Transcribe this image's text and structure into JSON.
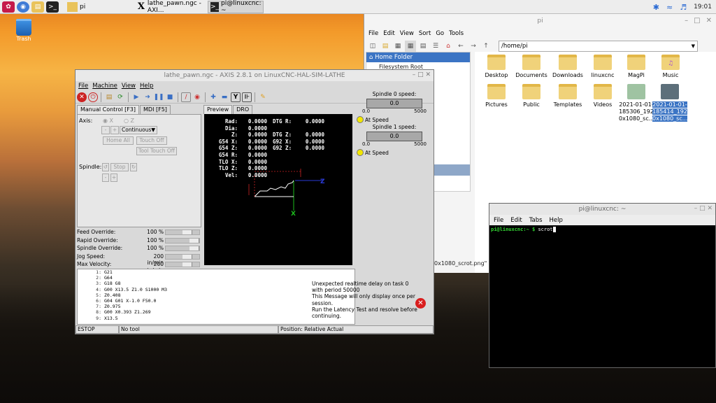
{
  "taskbar": {
    "tasks": [
      {
        "label": "pi",
        "active": false
      },
      {
        "label": "lathe_pawn.ngc - AXI...",
        "active": false
      },
      {
        "label": "pi@linuxcnc: ~",
        "active": true
      }
    ],
    "clock": "19:01"
  },
  "desktop": {
    "trash_label": "Trash"
  },
  "file_manager": {
    "title": "pi",
    "menu": [
      "File",
      "Edit",
      "View",
      "Sort",
      "Go",
      "Tools"
    ],
    "path": "/home/pi",
    "sidebar": {
      "selected": "Home Folder",
      "next": "Filesystem Root"
    },
    "items": [
      {
        "label": "Desktop",
        "icon": "desktop-folder-icon"
      },
      {
        "label": "Documents",
        "icon": "documents-folder-icon"
      },
      {
        "label": "Downloads",
        "icon": "downloads-folder-icon"
      },
      {
        "label": "linuxcnc",
        "icon": "folder-icon"
      },
      {
        "label": "MagPi",
        "icon": "folder-icon"
      },
      {
        "label": "Music",
        "icon": "music-folder-icon"
      },
      {
        "label": "Pictures",
        "icon": "pictures-folder-icon"
      },
      {
        "label": "Public",
        "icon": "public-folder-icon"
      },
      {
        "label": "Templates",
        "icon": "templates-folder-icon"
      },
      {
        "label": "Videos",
        "icon": "videos-folder-icon"
      },
      {
        "label": "2021-01-01-185306_1920x1080_sc...",
        "line1": "2021-01-01-",
        "line2": "185306_192",
        "line3": "0x1080_sc...",
        "icon": "image-file-icon"
      },
      {
        "label": "2021-01-01-185414_1920x1080_sc...",
        "line1": "2021-01-01-",
        "line2": "185414_192",
        "line3": "0x1080_sc...",
        "icon": "image-file-icon",
        "selected": true
      }
    ],
    "status_partial": "0x1080_scrot.png\" (1"
  },
  "terminal": {
    "title": "pi@linuxcnc: ~",
    "menu": [
      "File",
      "Edit",
      "Tabs",
      "Help"
    ],
    "prompt": "pi@linuxcnc:~ $",
    "command": "scrot"
  },
  "axis": {
    "title": "lathe_pawn.ngc - AXIS 2.8.1 on LinuxCNC-HAL-SIM-LATHE",
    "menu": [
      "File",
      "Machine",
      "View",
      "Help"
    ],
    "tabs_left": [
      "Manual Control [F3]",
      "MDI [F5]"
    ],
    "tabs_preview": [
      "Preview",
      "DRO"
    ],
    "manual": {
      "axis_label": "Axis:",
      "axis_x": "X",
      "axis_z": "Z",
      "minus": "-",
      "plus": "+",
      "jog_mode": "Continuous",
      "home_all": "Home All",
      "touch_off": "Touch Off",
      "tool_touch_off": "Tool Touch Off",
      "spindle_label": "Spindle:",
      "stop": "Stop"
    },
    "overrides": [
      {
        "label": "Feed Override:",
        "value": "100 %",
        "level": 0.7
      },
      {
        "label": "Rapid Override:",
        "value": "100 %",
        "level": 1.0
      },
      {
        "label": "Spindle Override:",
        "value": "100 %",
        "level": 1.0
      },
      {
        "label": "Jog Speed:",
        "value": "200 in/min",
        "level": 0.7
      },
      {
        "label": "Max Velocity:",
        "value": "200 in/min",
        "level": 0.7
      }
    ],
    "dro": [
      {
        "l": "Rad:",
        "v": "0.0000",
        "l2": "DTG R:",
        "v2": "0.0000"
      },
      {
        "l": "Dia:",
        "v": "0.0000",
        "l2": "",
        "v2": ""
      },
      {
        "l": "Z:",
        "v": "0.0000",
        "l2": "DTG Z:",
        "v2": "0.0000"
      },
      {
        "l": "G54 X:",
        "v": "0.0000",
        "l2": "G92 X:",
        "v2": "0.0000"
      },
      {
        "l": "G54 Z:",
        "v": "0.0000",
        "l2": "G92 Z:",
        "v2": "0.0000"
      },
      {
        "l": "G54 R:",
        "v": "0.0000",
        "l2": "",
        "v2": ""
      },
      {
        "l": "TLO X:",
        "v": "0.0000",
        "l2": "",
        "v2": ""
      },
      {
        "l": "TLO Z:",
        "v": "0.0000",
        "l2": "",
        "v2": ""
      },
      {
        "l": "Vel:",
        "v": "0.0000",
        "l2": "",
        "v2": ""
      }
    ],
    "preview_axes": {
      "x": "X",
      "z": "Z"
    },
    "spindle0": {
      "label": "Spindle 0 speed:",
      "value": "0.0",
      "min": "0.0",
      "max": "5000",
      "at_speed": "At Speed"
    },
    "spindle1": {
      "label": "Spindle 1 speed:",
      "value": "0.0",
      "min": "0.0",
      "max": "5000",
      "at_speed": "At Speed"
    },
    "gcode": [
      {
        "n": "1:",
        "t": "G21"
      },
      {
        "n": "2:",
        "t": "G64"
      },
      {
        "n": "3:",
        "t": "G18 G8"
      },
      {
        "n": "4:",
        "t": "G00 X13.5 Z1.0 S1000 M3"
      },
      {
        "n": "5:",
        "t": "Z0.408"
      },
      {
        "n": "6:",
        "t": "G04 G01 X-1.0 F50.0"
      },
      {
        "n": "7:",
        "t": "Z0.975"
      },
      {
        "n": "8:",
        "t": "G00 X0.393 Z1.269"
      },
      {
        "n": "9:",
        "t": "X13.5"
      }
    ],
    "message": "Unexpected realtime delay on task 0 with period 50000\nThis Message will only display once per session.\nRun the Latency Test and resolve before continuing.",
    "status": {
      "state": "ESTOP",
      "tool": "No tool",
      "position": "Position: Relative Actual"
    }
  }
}
